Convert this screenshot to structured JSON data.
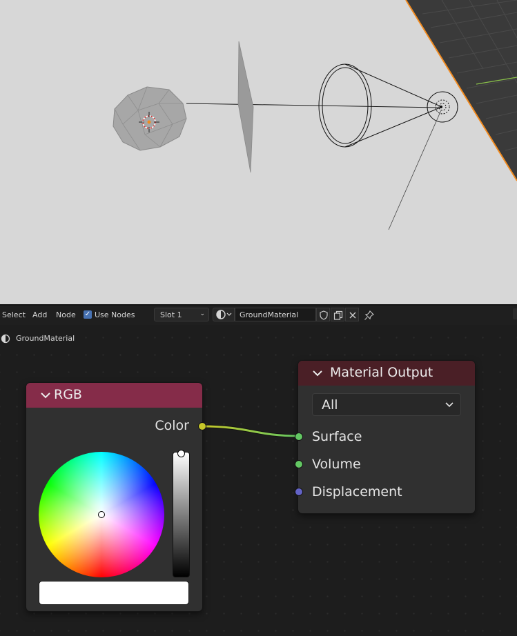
{
  "node_editor_header": {
    "menus": [
      "Select",
      "Add",
      "Node"
    ],
    "use_nodes": {
      "label": "Use Nodes",
      "checked": true
    },
    "slot": {
      "value": "Slot 1"
    },
    "material": {
      "name": "GroundMaterial"
    }
  },
  "breadcrumb": {
    "label": "GroundMaterial"
  },
  "rgb_node": {
    "title": "RGB",
    "outputs": [
      "Color"
    ],
    "color_value": "#ffffff",
    "value_level": 1.0,
    "header_color": "#852c49"
  },
  "material_output_node": {
    "title": "Material Output",
    "target": "All",
    "inputs": [
      "Surface",
      "Volume",
      "Displacement"
    ],
    "header_color": "#4a1f26"
  },
  "links": [
    {
      "from": "RGB.Color",
      "to": "Material Output.Surface"
    }
  ],
  "colors": {
    "viewport_bg": "#d7d7d7",
    "socket_color": "#c7c729",
    "socket_shader": "#63c763",
    "socket_vector": "#6363c7",
    "selection_orange": "#f28b1f",
    "accent_blue": "#4772b3"
  }
}
